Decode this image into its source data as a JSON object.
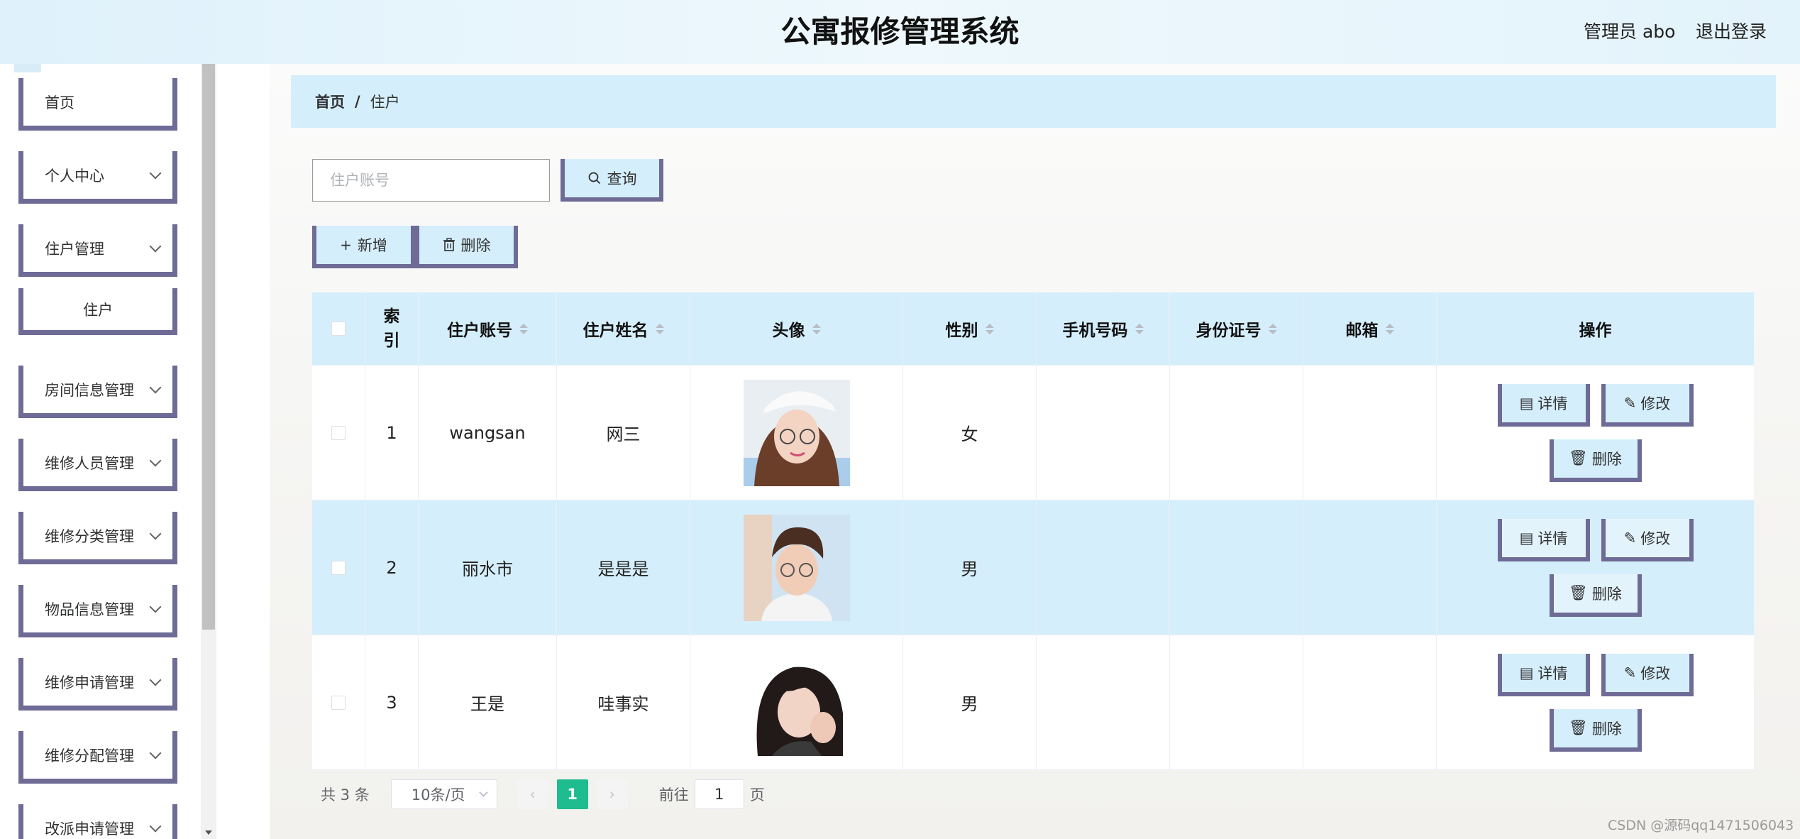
{
  "header": {
    "title": "公寓报修管理系统",
    "admin": "管理员 abo",
    "logout": "退出登录"
  },
  "sidebar": {
    "items": [
      {
        "label": "首页"
      },
      {
        "label": "个人中心"
      },
      {
        "label": "住户管理"
      },
      {
        "label": "住户"
      },
      {
        "label": "房间信息管理"
      },
      {
        "label": "维修人员管理"
      },
      {
        "label": "维修分类管理"
      },
      {
        "label": "物品信息管理"
      },
      {
        "label": "维修申请管理"
      },
      {
        "label": "维修分配管理"
      },
      {
        "label": "改派申请管理"
      }
    ]
  },
  "breadcrumb": {
    "home": "首页",
    "separator": "/",
    "current": "住户"
  },
  "search": {
    "placeholder": "住户账号",
    "button": "查询"
  },
  "toolbar": {
    "add": "新增",
    "delete": "删除"
  },
  "table": {
    "headers": {
      "index": "索引",
      "account": "住户账号",
      "name": "住户姓名",
      "avatar": "头像",
      "gender": "性别",
      "phone": "手机号码",
      "idcard": "身份证号",
      "email": "邮箱",
      "actions": "操作"
    },
    "rows": [
      {
        "index": "1",
        "account": "wangsan",
        "name": "网三",
        "gender": "女",
        "phone": "",
        "idcard": "",
        "email": ""
      },
      {
        "index": "2",
        "account": "丽水市",
        "name": "是是是",
        "gender": "男",
        "phone": "",
        "idcard": "",
        "email": ""
      },
      {
        "index": "3",
        "account": "王是",
        "name": "哇事实",
        "gender": "男",
        "phone": "",
        "idcard": "",
        "email": ""
      }
    ],
    "row_actions": {
      "detail": "详情",
      "edit": "修改",
      "delete": "删除"
    }
  },
  "pagination": {
    "total": "共 3 条",
    "page_size": "10条/页",
    "current_page": "1",
    "goto_label": "前往",
    "goto_value": "1",
    "page_unit": "页"
  },
  "watermark": "CSDN @源码qq1471506043",
  "colors": {
    "accent_border": "#6e6b96",
    "light_blue": "#d5eefb",
    "active_page": "#1ebc8f"
  }
}
